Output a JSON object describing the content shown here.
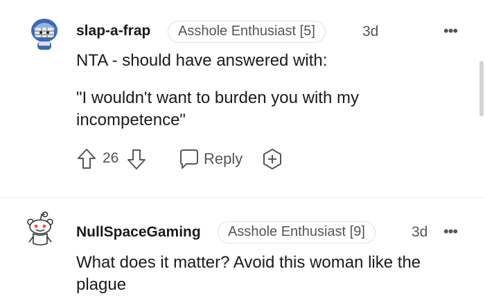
{
  "comments": [
    {
      "username": "slap-a-frap",
      "flair": "Asshole Enthusiast [5]",
      "age": "3d",
      "more": "•••",
      "body": [
        "NTA - should have answered with:",
        "\"I wouldn't want to burden you with my incompetence\""
      ],
      "votes": "26",
      "reply_label": "Reply",
      "avatar_icon": "snoo-football-helmet-avatar"
    },
    {
      "username": "NullSpaceGaming",
      "flair": "Asshole Enthusiast [9]",
      "age": "3d",
      "more": "•••",
      "body": [
        "What does it matter? Avoid this woman like the plague"
      ],
      "avatar_icon": "snoo-default-avatar"
    }
  ],
  "colors": {
    "text": "#1a1a1b",
    "meta": "#555555",
    "border": "#e0e0e0",
    "helmet_blue": "#3c6bb5"
  }
}
